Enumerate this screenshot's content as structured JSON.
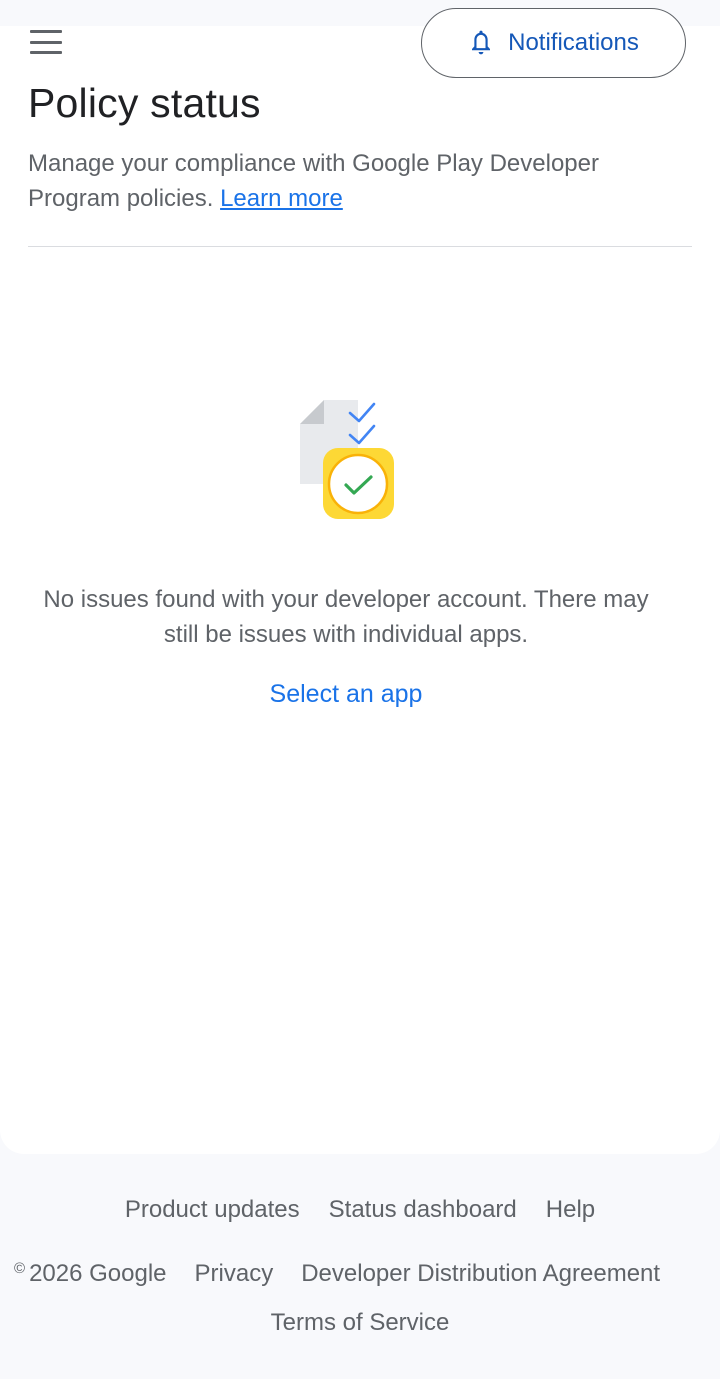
{
  "header": {
    "menu_icon": "hamburger-menu-icon",
    "notifications": {
      "icon": "bell-icon",
      "label": "Notifications"
    }
  },
  "main": {
    "title": "Policy status",
    "description": "Manage your compliance with Google Play Developer Program policies.",
    "learn_more": "Learn more",
    "illustration": "document-checklist-shield-icon",
    "empty_message": "No issues found with your developer account. There may still be issues with individual apps.",
    "select_app": "Select an app"
  },
  "footer": {
    "links_row1": [
      "Product updates",
      "Status dashboard",
      "Help"
    ],
    "copyright_symbol": "©",
    "copyright": "2026 Google",
    "links_row2": [
      "Privacy",
      "Developer Distribution Agreement"
    ],
    "terms": "Terms of Service"
  },
  "colors": {
    "link_blue": "#1a73e8",
    "text_gray": "#5f6368",
    "background": "#f8f9fc",
    "illustration_yellow": "#fdd835",
    "check_green": "#34a853"
  }
}
